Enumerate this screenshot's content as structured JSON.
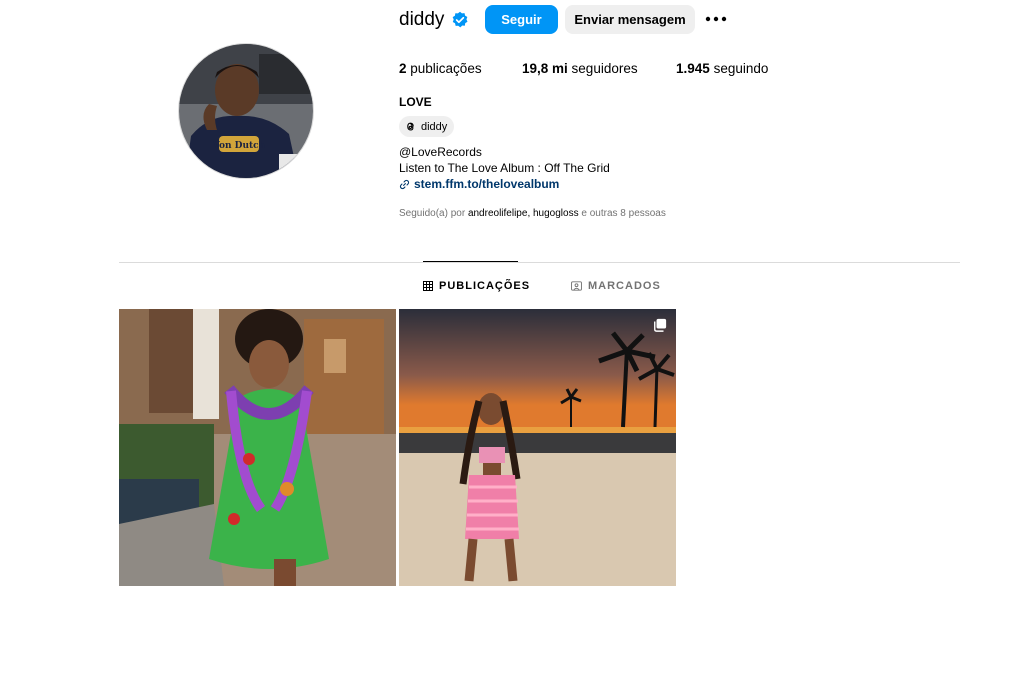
{
  "profile": {
    "username": "diddy",
    "follow_label": "Seguir",
    "message_label": "Enviar mensagem",
    "stats": {
      "posts_count": "2",
      "posts_label": "publicações",
      "followers_count": "19,8 mi",
      "followers_label": "seguidores",
      "following_count": "1.945",
      "following_label": "seguindo"
    },
    "full_name": "LOVE",
    "threads_handle": "diddy",
    "bio_lines": [
      "@LoveRecords",
      "Listen to The Love Album : Off The Grid"
    ],
    "link": "stem.ffm.to/thelovealbum",
    "followed_by": {
      "prefix": "Seguido(a) por",
      "user1": "andreolifelipe",
      "sep": ",",
      "user2": "hugogloss",
      "suffix": "e outras 8 pessoas"
    }
  },
  "tabs": [
    {
      "label": "PUBLICAÇÕES",
      "icon": "grid-icon",
      "active": true
    },
    {
      "label": "MARCADOS",
      "icon": "tagged-icon",
      "active": false
    }
  ],
  "posts": [
    {
      "icon": "photo",
      "multi": false
    },
    {
      "icon": "photo",
      "multi": true
    }
  ],
  "colors": {
    "primary_button": "#0095f6",
    "secondary_button": "#efefef",
    "verified": "#0095f6",
    "link": "#00376b",
    "muted": "#737373",
    "divider": "#dbdbdb"
  }
}
